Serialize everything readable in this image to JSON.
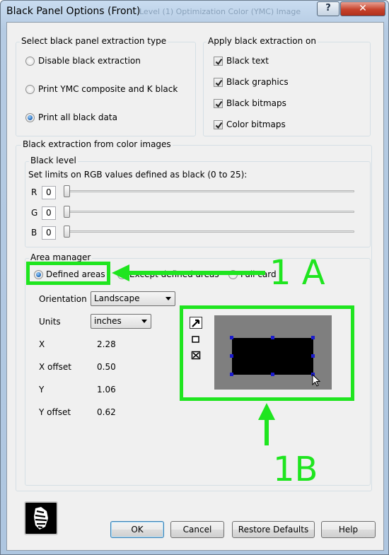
{
  "window": {
    "title": "Black Panel Options (Front)",
    "ghost_tabs": "Level (1)   Optimization   Color (YMC)   Image",
    "help_button": "?",
    "close_button": "✕"
  },
  "extraction_type": {
    "label": "Select black panel extraction type",
    "options": [
      {
        "label": "Disable black extraction",
        "checked": false
      },
      {
        "label": "Print YMC composite and K black",
        "checked": false
      },
      {
        "label": "Print all black data",
        "checked": true
      }
    ]
  },
  "apply_on": {
    "label": "Apply black extraction on",
    "options": [
      {
        "label": "Black text",
        "checked": true
      },
      {
        "label": "Black graphics",
        "checked": true
      },
      {
        "label": "Black bitmaps",
        "checked": true
      },
      {
        "label": "Color bitmaps",
        "checked": true
      }
    ]
  },
  "color_images": {
    "label": "Black extraction from color images",
    "black_level": {
      "label": "Black level",
      "instruction": "Set limits on RGB values defined as black (0 to 25):",
      "channels": [
        {
          "name": "R",
          "value": "0",
          "level": 0
        },
        {
          "name": "G",
          "value": "0",
          "level": 0
        },
        {
          "name": "B",
          "value": "0",
          "level": 0
        }
      ]
    },
    "area_manager": {
      "label": "Area manager",
      "modes": [
        {
          "label": "Defined areas",
          "checked": true
        },
        {
          "label": "Except defined areas",
          "checked": false
        },
        {
          "label": "Full card",
          "checked": false
        }
      ],
      "orientation_label": "Orientation",
      "orientation_value": "Landscape",
      "units_label": "Units",
      "units_value": "inches",
      "fields": [
        {
          "label": "X",
          "value": "2.28"
        },
        {
          "label": "X offset",
          "value": "0.50"
        },
        {
          "label": "Y",
          "value": "1.06"
        },
        {
          "label": "Y offset",
          "value": "0.62"
        }
      ],
      "tools": [
        "select-arrow-icon",
        "rectangle-icon",
        "delete-area-icon"
      ]
    }
  },
  "annotations": {
    "a": "1 A",
    "b": "1B",
    "color": "#1fe51f"
  },
  "buttons": {
    "ok": "OK",
    "cancel": "Cancel",
    "restore": "Restore Defaults",
    "help": "Help"
  },
  "logo": "zebra-logo-icon"
}
